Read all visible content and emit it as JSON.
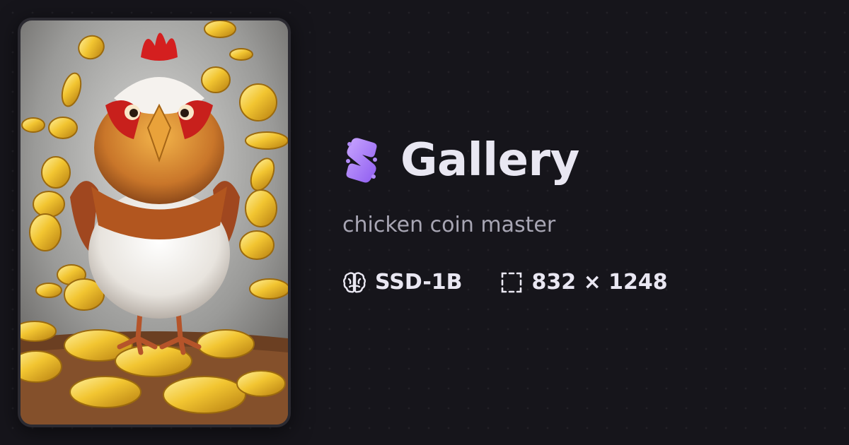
{
  "header": {
    "logo_icon": "gallery-logo-icon",
    "title": "Gallery"
  },
  "subtitle": "chicken coin master",
  "meta": {
    "model_icon": "brain-icon",
    "model": "SSD-1B",
    "dimensions_icon": "dashed-square-icon",
    "dimensions": "832 × 1248"
  },
  "colors": {
    "background": "#16151b",
    "title": "#e9e7f2",
    "subtitle": "#a8a6b4",
    "accent_purple": "#b28cf8"
  }
}
